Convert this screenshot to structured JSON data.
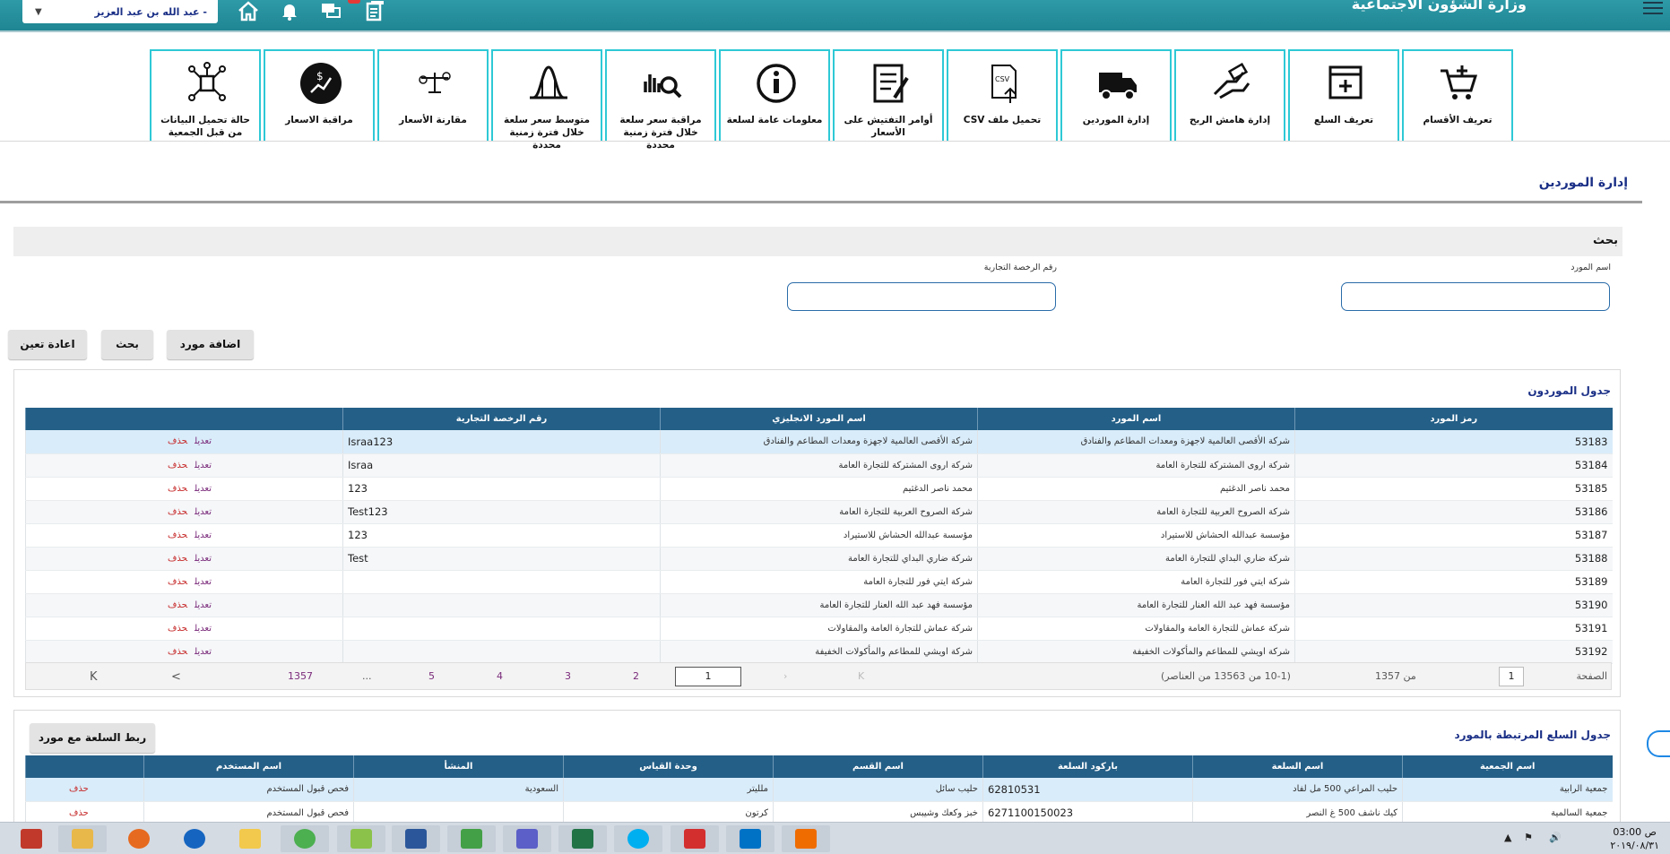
{
  "header": {
    "ministry": "وزارة الشؤون الاجتماعية",
    "user_name": "عبد الله بن عبد العزيز",
    "user_prefix": "-"
  },
  "tiles": [
    {
      "label": "تعريف الأقسام",
      "icon": "cart-add-icon"
    },
    {
      "label": "تعريف السلع",
      "icon": "window-add-icon"
    },
    {
      "label": "إدارة هامش الربح",
      "icon": "hand-money-icon"
    },
    {
      "label": "إدارة الموردين",
      "icon": "truck-icon"
    },
    {
      "label": "تحميل ملف CSV",
      "icon": "csv-upload-icon"
    },
    {
      "label": "أوامر التفتيش على الأسعار",
      "icon": "checklist-icon"
    },
    {
      "label": "معلومات عامة لسلعة",
      "icon": "info-icon"
    },
    {
      "label": "مراقبة سعر سلعة خلال فترة زمنية محددة",
      "icon": "chart-search-icon"
    },
    {
      "label": "متوسط سعر سلعة خلال فترة زمنية محددة",
      "icon": "bell-curve-icon"
    },
    {
      "label": "مقارنة الأسعار",
      "icon": "balance-scale-icon"
    },
    {
      "label": "مراقبة الاسعار",
      "icon": "price-monitor-icon"
    },
    {
      "label": "حالة تحميل البيانات من قبل الجمعية",
      "icon": "data-network-icon"
    }
  ],
  "page_title": "إدارة الموردين",
  "search": {
    "title": "بحث",
    "supplier_name_label": "اسم المورد",
    "supplier_name_value": "",
    "license_label": "رقم الرخصة التجارية",
    "license_value": ""
  },
  "buttons": {
    "add": "اضافة مورد",
    "search": "بحث",
    "reset": "اعادة تعين",
    "link": "ربط السلعة مع مورد"
  },
  "suppliers_table": {
    "title": "جدول الموردون",
    "columns": [
      "رمز المورد",
      "اسم المورد",
      "اسم المورد الانجليزي",
      "رقم الرخصة التجارية",
      ""
    ],
    "edit_label": "تعديل",
    "delete_label": "حذف",
    "rows": [
      {
        "code": "53183",
        "name": "شركة الأقصى العالمية لاجهزة ومعدات المطاعم والفنادق",
        "name_en": "شركة الأقصى العالمية لاجهزة ومعدات المطاعم والفنادق",
        "license": "Israa123"
      },
      {
        "code": "53184",
        "name": "شركة اروى المشتركة للتجارة العامة",
        "name_en": "شركة اروى المشتركة للتجارة العامة",
        "license": "Israa"
      },
      {
        "code": "53185",
        "name": "محمد ناصر الدغثيم",
        "name_en": "محمد ناصر الدغثيم",
        "license": "123"
      },
      {
        "code": "53186",
        "name": "شركة الصروح العربية للتجارة العامة",
        "name_en": "شركة الصروح العربية للتجارة العامة",
        "license": "Test123"
      },
      {
        "code": "53187",
        "name": "مؤسسة عبدالله الحشاش للاستيراد",
        "name_en": "مؤسسة عبدالله الحشاش للاستيراد",
        "license": "123"
      },
      {
        "code": "53188",
        "name": "شركة ضاري البداي للتجارة العامة",
        "name_en": "شركة ضاري البداي للتجارة العامة",
        "license": "Test"
      },
      {
        "code": "53189",
        "name": "شركة ايتي فور للتجارة العامة",
        "name_en": "شركة ايتي فور للتجارة العامة",
        "license": ""
      },
      {
        "code": "53190",
        "name": "مؤسسة فهد عبد الله العنار للتجارة العامة",
        "name_en": "مؤسسة فهد عبد الله العنار للتجارة العامة",
        "license": ""
      },
      {
        "code": "53191",
        "name": "شركة عماش للتجارة العامة والمقاولات",
        "name_en": "شركة عماش للتجارة العامة والمقاولات",
        "license": ""
      },
      {
        "code": "53192",
        "name": "شركة اويشي للمطاعم والمأكولات الخفيفة",
        "name_en": "شركة اويشي للمطاعم والمأكولات الخفيفة",
        "license": ""
      }
    ],
    "pager": {
      "page_label": "الصفحة",
      "page_value": "1",
      "of_label": "من 1357",
      "summary": "(10-1 من 13563 من العناصر)",
      "current": "1",
      "pages": [
        "2",
        "3",
        "4",
        "5",
        "...",
        "1357"
      ],
      "first": "K",
      "prev": "<",
      "next": "›",
      "last": "K"
    }
  },
  "items_table": {
    "title": "جدول السلع المرتبطة بالمورد",
    "columns": [
      "اسم الجمعية",
      "اسم السلعة",
      "باركود السلعة",
      "اسم القسم",
      "وحدة القياس",
      "المنشأ",
      "اسم المستخدم",
      ""
    ],
    "delete_label": "حذف",
    "rows": [
      {
        "assoc": "جمعية الرابية",
        "item": "حليب المراعي 500 مل لفاد",
        "barcode": "62810531",
        "dept": "حليب سائل",
        "unit": "ملليتر",
        "origin": "السعودية",
        "user": "فحص قبول المستخدم"
      },
      {
        "assoc": "جمعية السالمية",
        "item": "كيك ناشف 500 غ النصر",
        "barcode": "6271100150023",
        "dept": "خبز وكعك وشيبس",
        "unit": "كرتون",
        "origin": "",
        "user": "فحص قبول المستخدم"
      }
    ]
  },
  "taskbar": {
    "time": "03:00 ص",
    "date": "٢٠١٩/٠٨/٣١"
  }
}
